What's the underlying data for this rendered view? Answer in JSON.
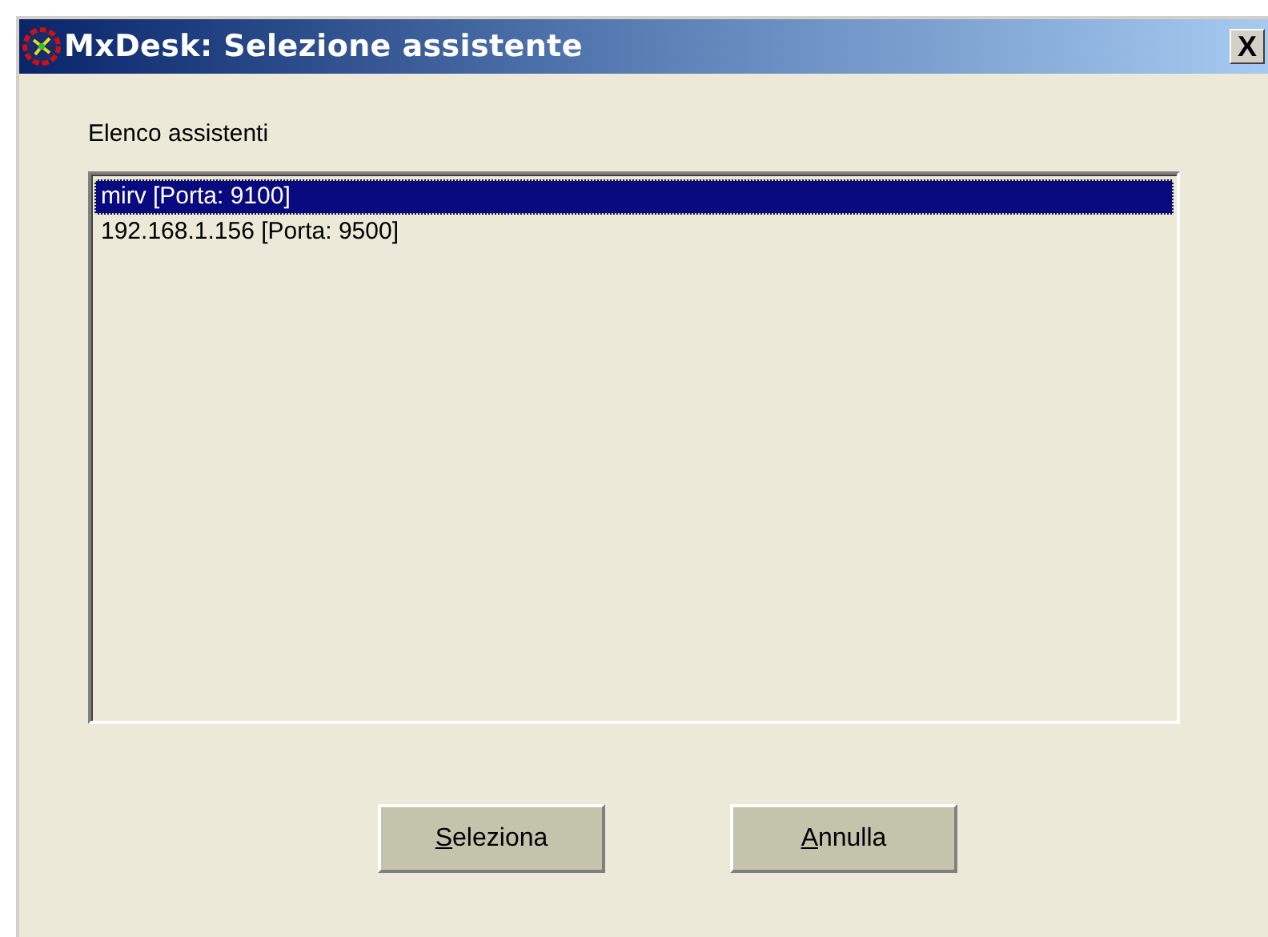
{
  "window": {
    "title": "MxDesk: Selezione assistente",
    "close_label": "X"
  },
  "list": {
    "label": "Elenco assistenti",
    "items": [
      {
        "text": "mirv  [Porta: 9100]",
        "selected": true
      },
      {
        "text": "192.168.1.156  [Porta: 9500]",
        "selected": false
      }
    ]
  },
  "buttons": [
    "Seleziona",
    "Annulla"
  ]
}
